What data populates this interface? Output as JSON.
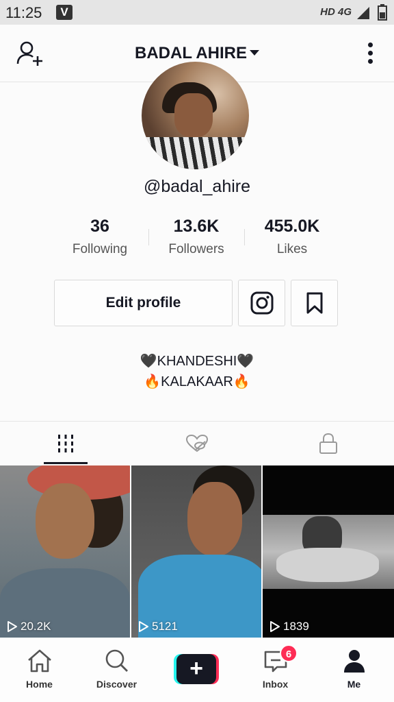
{
  "status_bar": {
    "time": "11:25",
    "app_badge": "V",
    "network": "HD 4G"
  },
  "header": {
    "title": "BADAL AHIRE"
  },
  "profile": {
    "username": "@badal_ahire",
    "stats": [
      {
        "value": "36",
        "label": "Following"
      },
      {
        "value": "13.6K",
        "label": "Followers"
      },
      {
        "value": "455.0K",
        "label": "Likes"
      }
    ],
    "edit_button": "Edit profile",
    "bio_lines": [
      "🖤KHANDESHI🖤",
      "🔥KALAKAAR🔥"
    ]
  },
  "tabs": [
    {
      "name": "videos-grid-icon",
      "active": true
    },
    {
      "name": "liked-hidden-icon",
      "active": false
    },
    {
      "name": "private-lock-icon",
      "active": false
    }
  ],
  "videos": [
    {
      "views": "20.2K"
    },
    {
      "views": "5121"
    },
    {
      "views": "1839"
    }
  ],
  "bottom_nav": {
    "home": "Home",
    "discover": "Discover",
    "inbox": "Inbox",
    "inbox_badge": "6",
    "me": "Me"
  },
  "colors": {
    "accent": "#fe2c55",
    "cyan": "#25f4ee",
    "text": "#161823"
  }
}
